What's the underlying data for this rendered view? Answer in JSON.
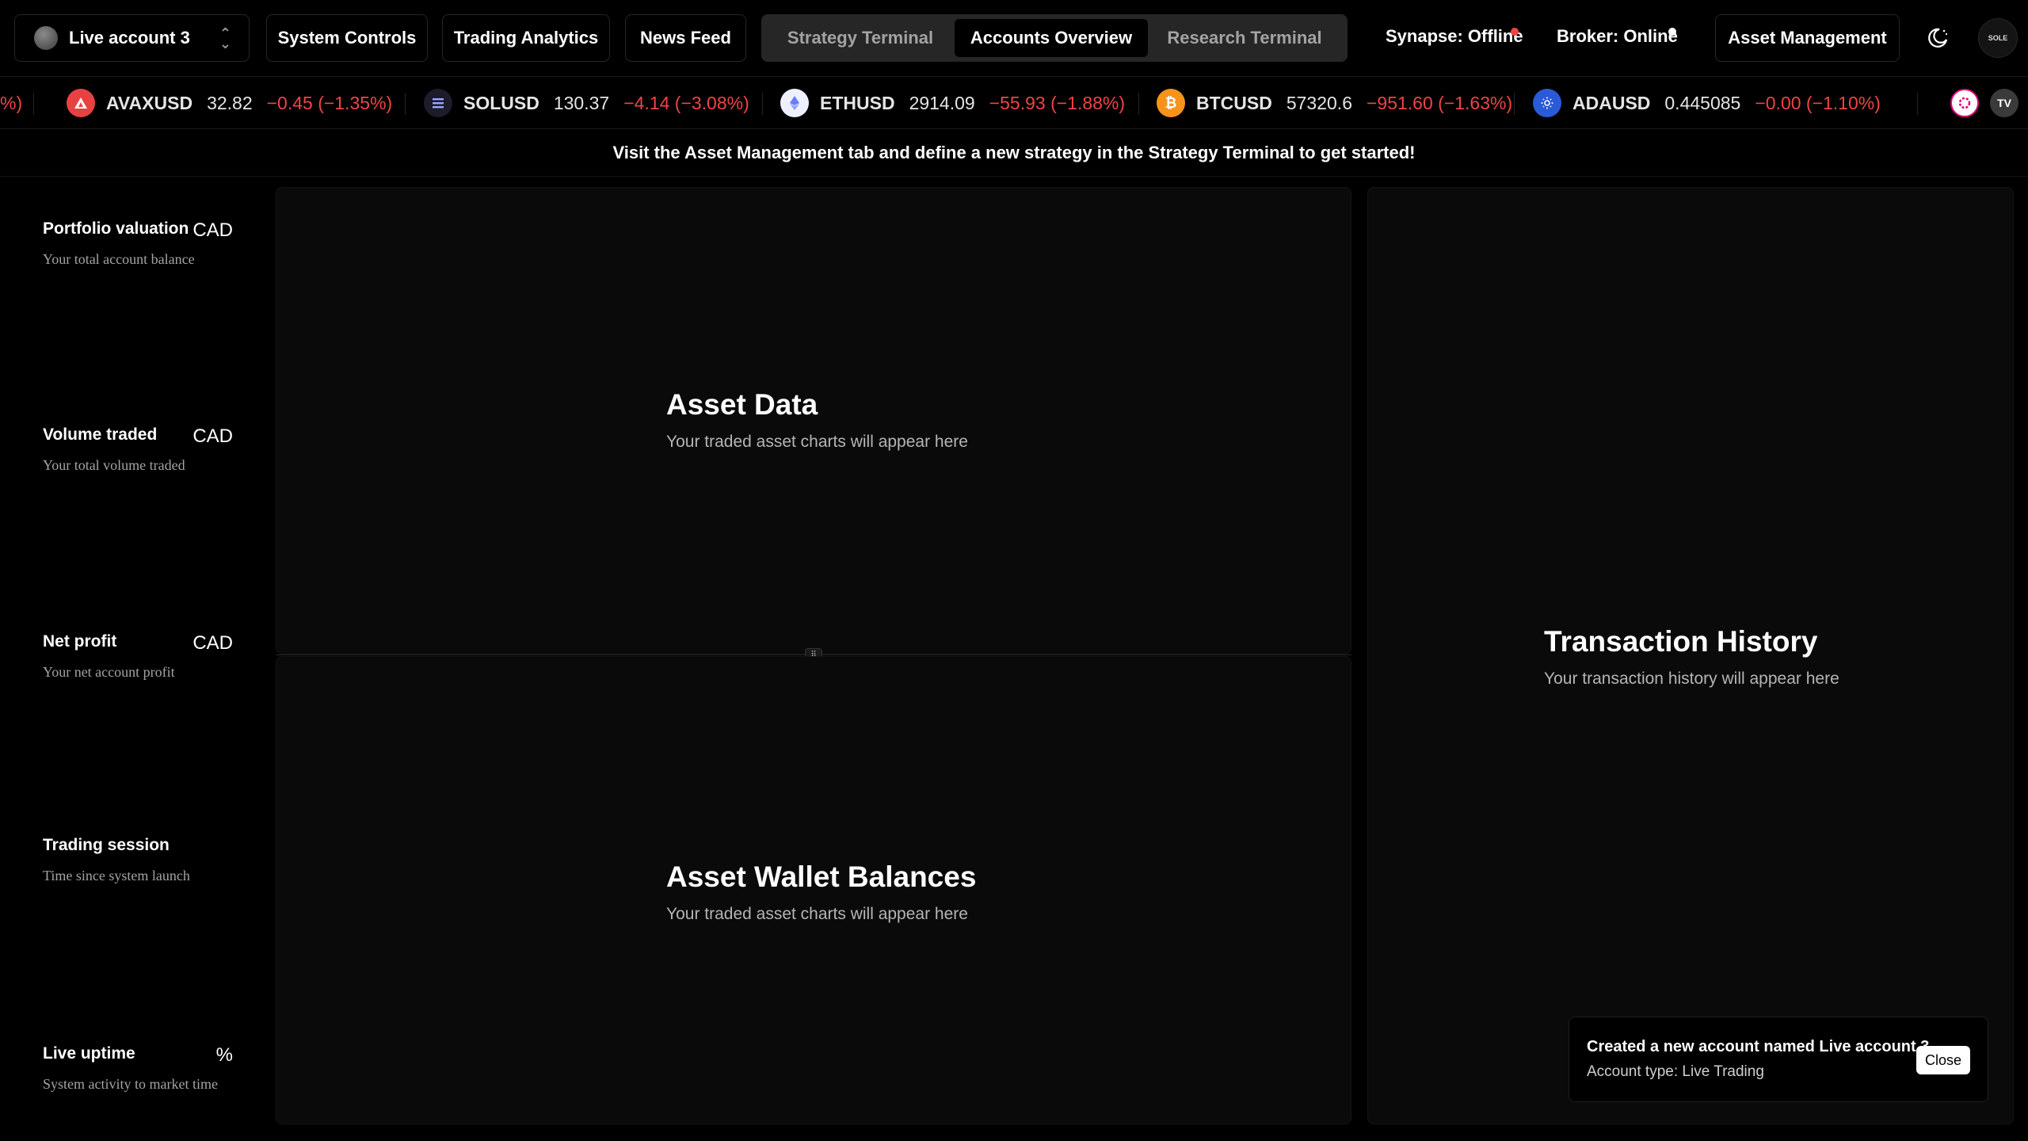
{
  "header": {
    "account_name": "Live account 3",
    "buttons": {
      "system_controls": "System Controls",
      "trading_analytics": "Trading Analytics",
      "news_feed": "News Feed",
      "asset_management": "Asset Management"
    },
    "tabs": [
      {
        "label": "Strategy Terminal",
        "active": false
      },
      {
        "label": "Accounts Overview",
        "active": true
      },
      {
        "label": "Research Terminal",
        "active": false
      }
    ],
    "synapse_status": "Synapse: Offline",
    "broker_status": "Broker: Online",
    "avatar_text": "SOLE",
    "colors": {
      "offline_dot": "#ef4444",
      "online_dot": "#ffffff",
      "negative": "#ef4444"
    }
  },
  "ticker": [
    {
      "symbol": "AVAXUSD",
      "price": "32.82",
      "change": "−0.45 (−1.35%)",
      "icon": "avalanche-logo-icon",
      "color": "#e84142"
    },
    {
      "symbol": "SOLUSD",
      "price": "130.37",
      "change": "−4.14 (−3.08%)",
      "icon": "solana-logo-icon",
      "color": "#1c1c2a"
    },
    {
      "symbol": "ETHUSD",
      "price": "2914.09",
      "change": "−55.93 (−1.88%)",
      "icon": "ethereum-logo-icon",
      "color": "#eef0ff"
    },
    {
      "symbol": "BTCUSD",
      "price": "57320.6",
      "change": "−951.60 (−1.63%)",
      "icon": "bitcoin-logo-icon",
      "color": "#f7931a"
    },
    {
      "symbol": "ADAUSD",
      "price": "0.445085",
      "change": "−0.00 (−1.10%)",
      "icon": "cardano-logo-icon",
      "color": "#2a5bd7"
    }
  ],
  "ticker_leading_fragment": "%)",
  "banner": "Visit the Asset Management tab and define a new strategy in the Strategy Terminal to get started!",
  "stats": [
    {
      "label": "Portfolio valuation",
      "unit": "CAD",
      "desc": "Your total account balance"
    },
    {
      "label": "Volume traded",
      "unit": "CAD",
      "desc": "Your total volume traded"
    },
    {
      "label": "Net profit",
      "unit": "CAD",
      "desc": "Your net account profit"
    },
    {
      "label": "Trading session",
      "unit": "",
      "desc": "Time since system launch"
    },
    {
      "label": "Live uptime",
      "unit": "%",
      "desc": "System activity to market time"
    }
  ],
  "panels": {
    "asset_data": {
      "title": "Asset Data",
      "subtitle": "Your traded asset charts will appear here"
    },
    "wallet": {
      "title": "Asset Wallet Balances",
      "subtitle": "Your traded asset charts will appear here"
    },
    "transactions": {
      "title": "Transaction History",
      "subtitle": "Your transaction history will appear here"
    }
  },
  "toast": {
    "title": "Created a new account named Live account 3",
    "desc": "Account type: Live Trading",
    "close_label": "Close"
  }
}
